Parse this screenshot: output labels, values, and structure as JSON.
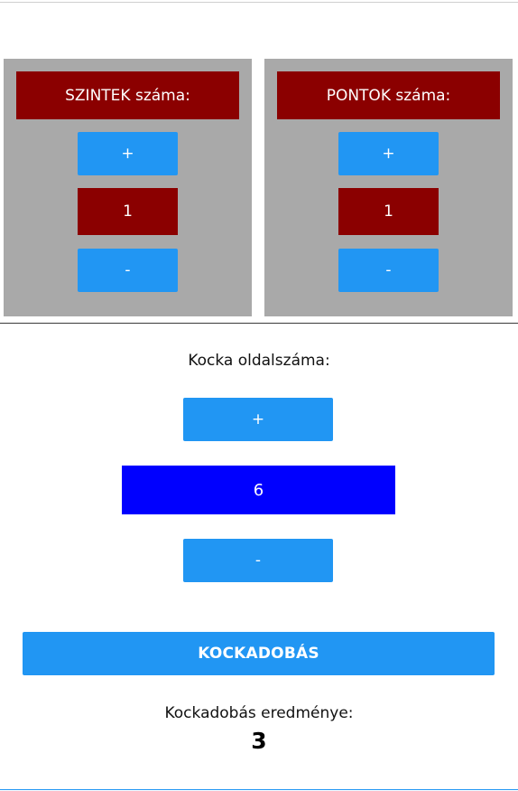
{
  "levels": {
    "title": "SZINTEK száma:",
    "plus_label": "+",
    "value": "1",
    "minus_label": "-"
  },
  "points": {
    "title": "PONTOK száma:",
    "plus_label": "+",
    "value": "1",
    "minus_label": "-"
  },
  "dice": {
    "label": "Kocka oldalszáma:",
    "plus_label": "+",
    "value": "6",
    "minus_label": "-"
  },
  "roll": {
    "button_label": "KOCKADOBÁS",
    "result_label": "Kockadobás eredménye:",
    "result_value": "3"
  },
  "colors": {
    "panel_bg": "#a9a9a9",
    "dark_red": "#8b0000",
    "button_blue": "#2196f3",
    "value_blue": "#0000ff"
  }
}
